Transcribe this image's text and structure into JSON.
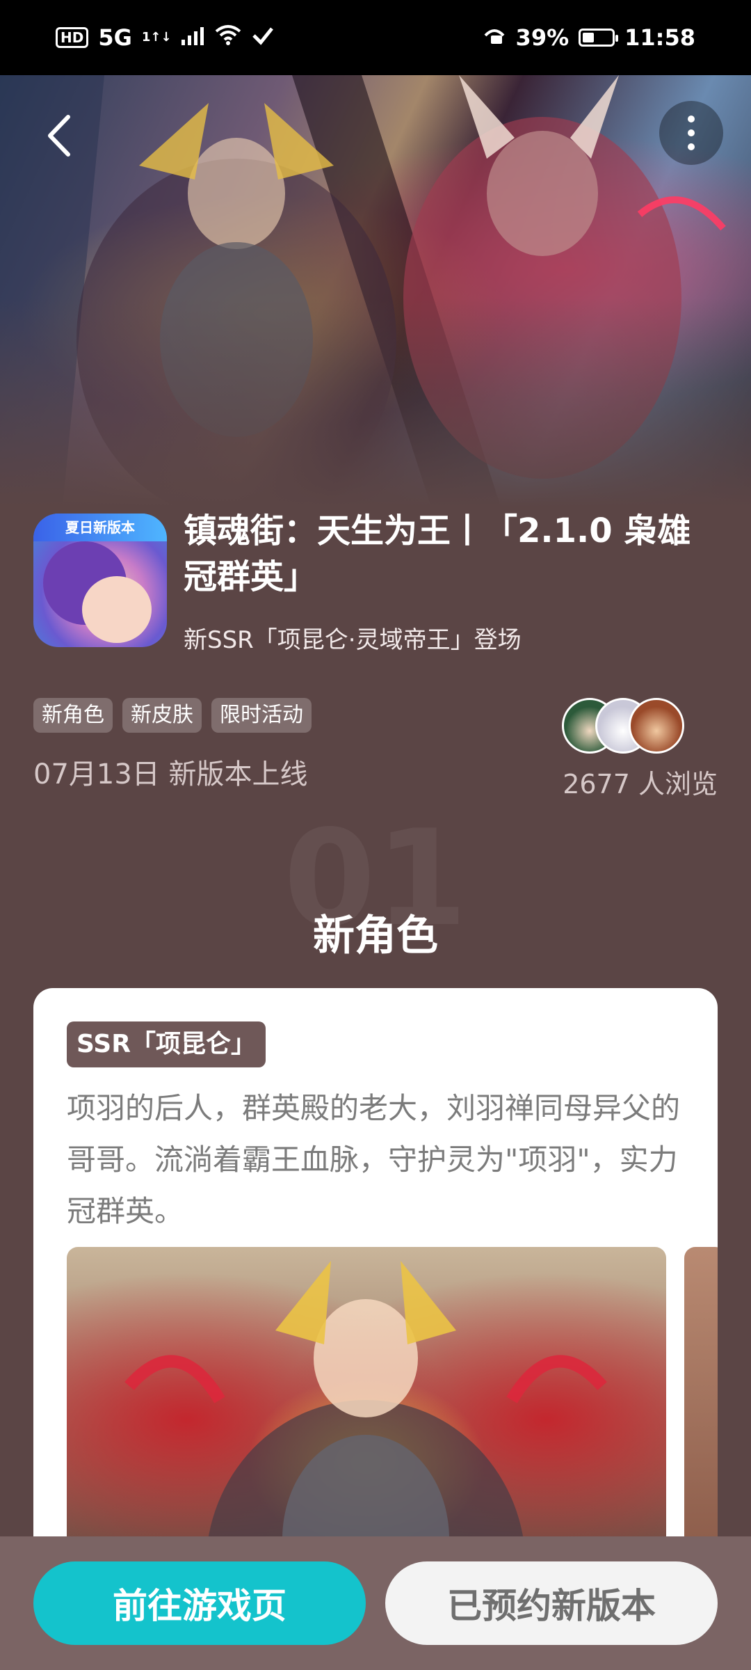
{
  "status_bar": {
    "hd": "HD",
    "network": "5G",
    "signal_sub": "1↑↓",
    "battery_percent": "39%",
    "battery_level": 0.39,
    "time": "11:58"
  },
  "app": {
    "icon_badge": "夏日新版本",
    "title": "镇魂街：天生为王丨「2.1.0 枭雄冠群英」",
    "subtitle": "新SSR「项昆仑·灵域帝王」登场",
    "tags": [
      "新角色",
      "新皮肤",
      "限时活动"
    ],
    "release_date": "07月13日 新版本上线",
    "views": "2677 人浏览"
  },
  "section": {
    "number": "01",
    "title": "新角色"
  },
  "card": {
    "badge": "SSR「项昆仑」",
    "description": "项羽的后人，群英殿的老大，刘羽禅同母异父的哥哥。流淌着霸王血脉，守护灵为\"项羽\"，实力冠群英。"
  },
  "actions": {
    "primary_label": "前往游戏页",
    "secondary_label": "已预约新版本"
  },
  "colors": {
    "background": "#5b4545",
    "primary_button": "#14c3cc",
    "secondary_button": "#f3f3f3",
    "badge": "#6f5858"
  },
  "icons": {
    "status": [
      "wifi-icon",
      "vpn-icon",
      "dnd-icon",
      "battery-icon"
    ],
    "nav": [
      "back-icon",
      "more-icon"
    ]
  }
}
